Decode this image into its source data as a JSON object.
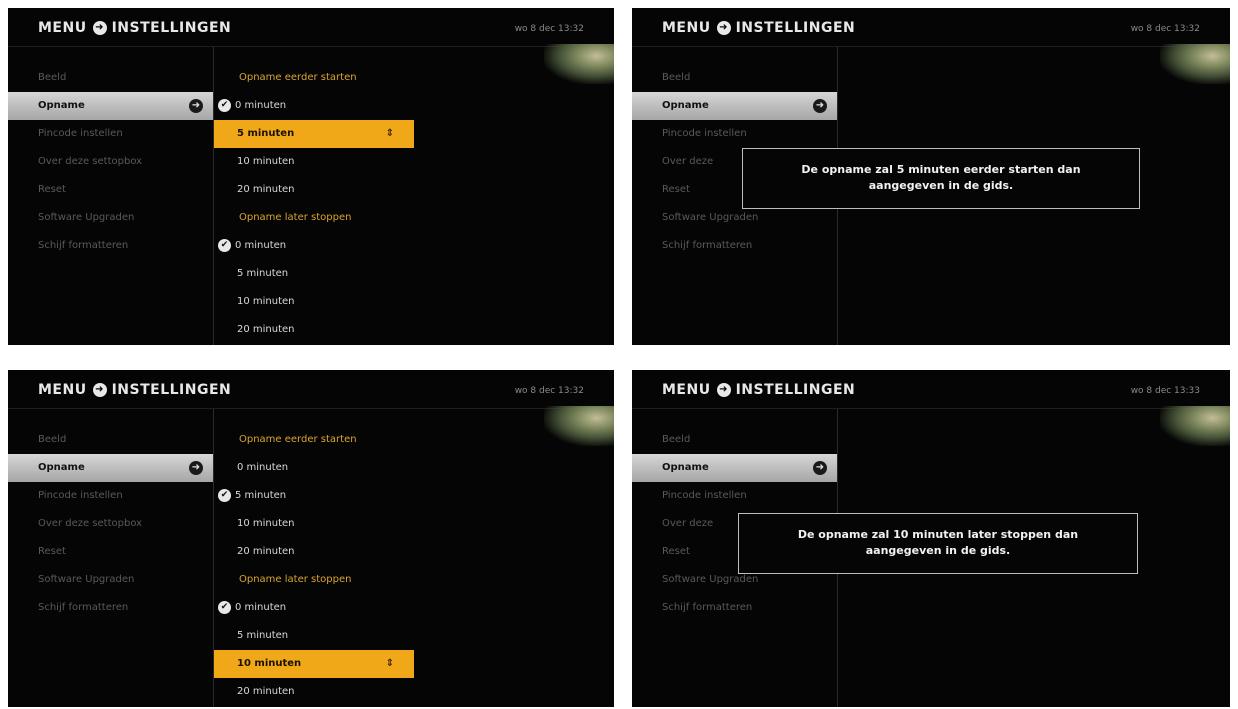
{
  "header": {
    "menu": "MENU",
    "settings": "INSTELLINGEN",
    "arrow_icon": "arrow-right-circle-icon"
  },
  "screens": [
    {
      "time": "wo 8 dec 13:32",
      "sidebar": [
        "Beeld",
        "Opname",
        "Pincode instellen",
        "Over deze settopbox",
        "Reset",
        "Software Upgraden",
        "Schijf formatteren"
      ],
      "options": [
        "Opname eerder starten",
        "0 minuten",
        "5 minuten",
        "10 minuten",
        "20 minuten",
        "Opname later stoppen",
        "0 minuten",
        "5 minuten",
        "10 minuten",
        "20 minuten"
      ]
    },
    {
      "time": "wo 8 dec 13:32",
      "sidebar": [
        "Beeld",
        "Opname",
        "Pincode instellen",
        "Over deze",
        "Reset",
        "Software Upgraden",
        "Schijf formatteren"
      ],
      "dialog": [
        "De opname zal 5 minuten eerder starten dan",
        "aangegeven in de gids."
      ]
    },
    {
      "time": "wo 8 dec 13:32",
      "sidebar": [
        "Beeld",
        "Opname",
        "Pincode instellen",
        "Over deze settopbox",
        "Reset",
        "Software Upgraden",
        "Schijf formatteren"
      ],
      "options": [
        "Opname eerder starten",
        "0 minuten",
        "5 minuten",
        "10 minuten",
        "20 minuten",
        "Opname later stoppen",
        "0 minuten",
        "5 minuten",
        "10 minuten",
        "20 minuten"
      ]
    },
    {
      "time": "wo 8 dec 13:33",
      "sidebar": [
        "Beeld",
        "Opname",
        "Pincode instellen",
        "Over deze",
        "Reset",
        "Software Upgraden",
        "Schijf formatteren"
      ],
      "dialog": [
        "De opname zal 10 minuten later stoppen dan",
        "aangegeven in de gids."
      ]
    }
  ],
  "colors": {
    "background": "#050505",
    "highlight": "#f0a818",
    "heading": "#d9a52e",
    "active_item": "#c8c8c8"
  }
}
